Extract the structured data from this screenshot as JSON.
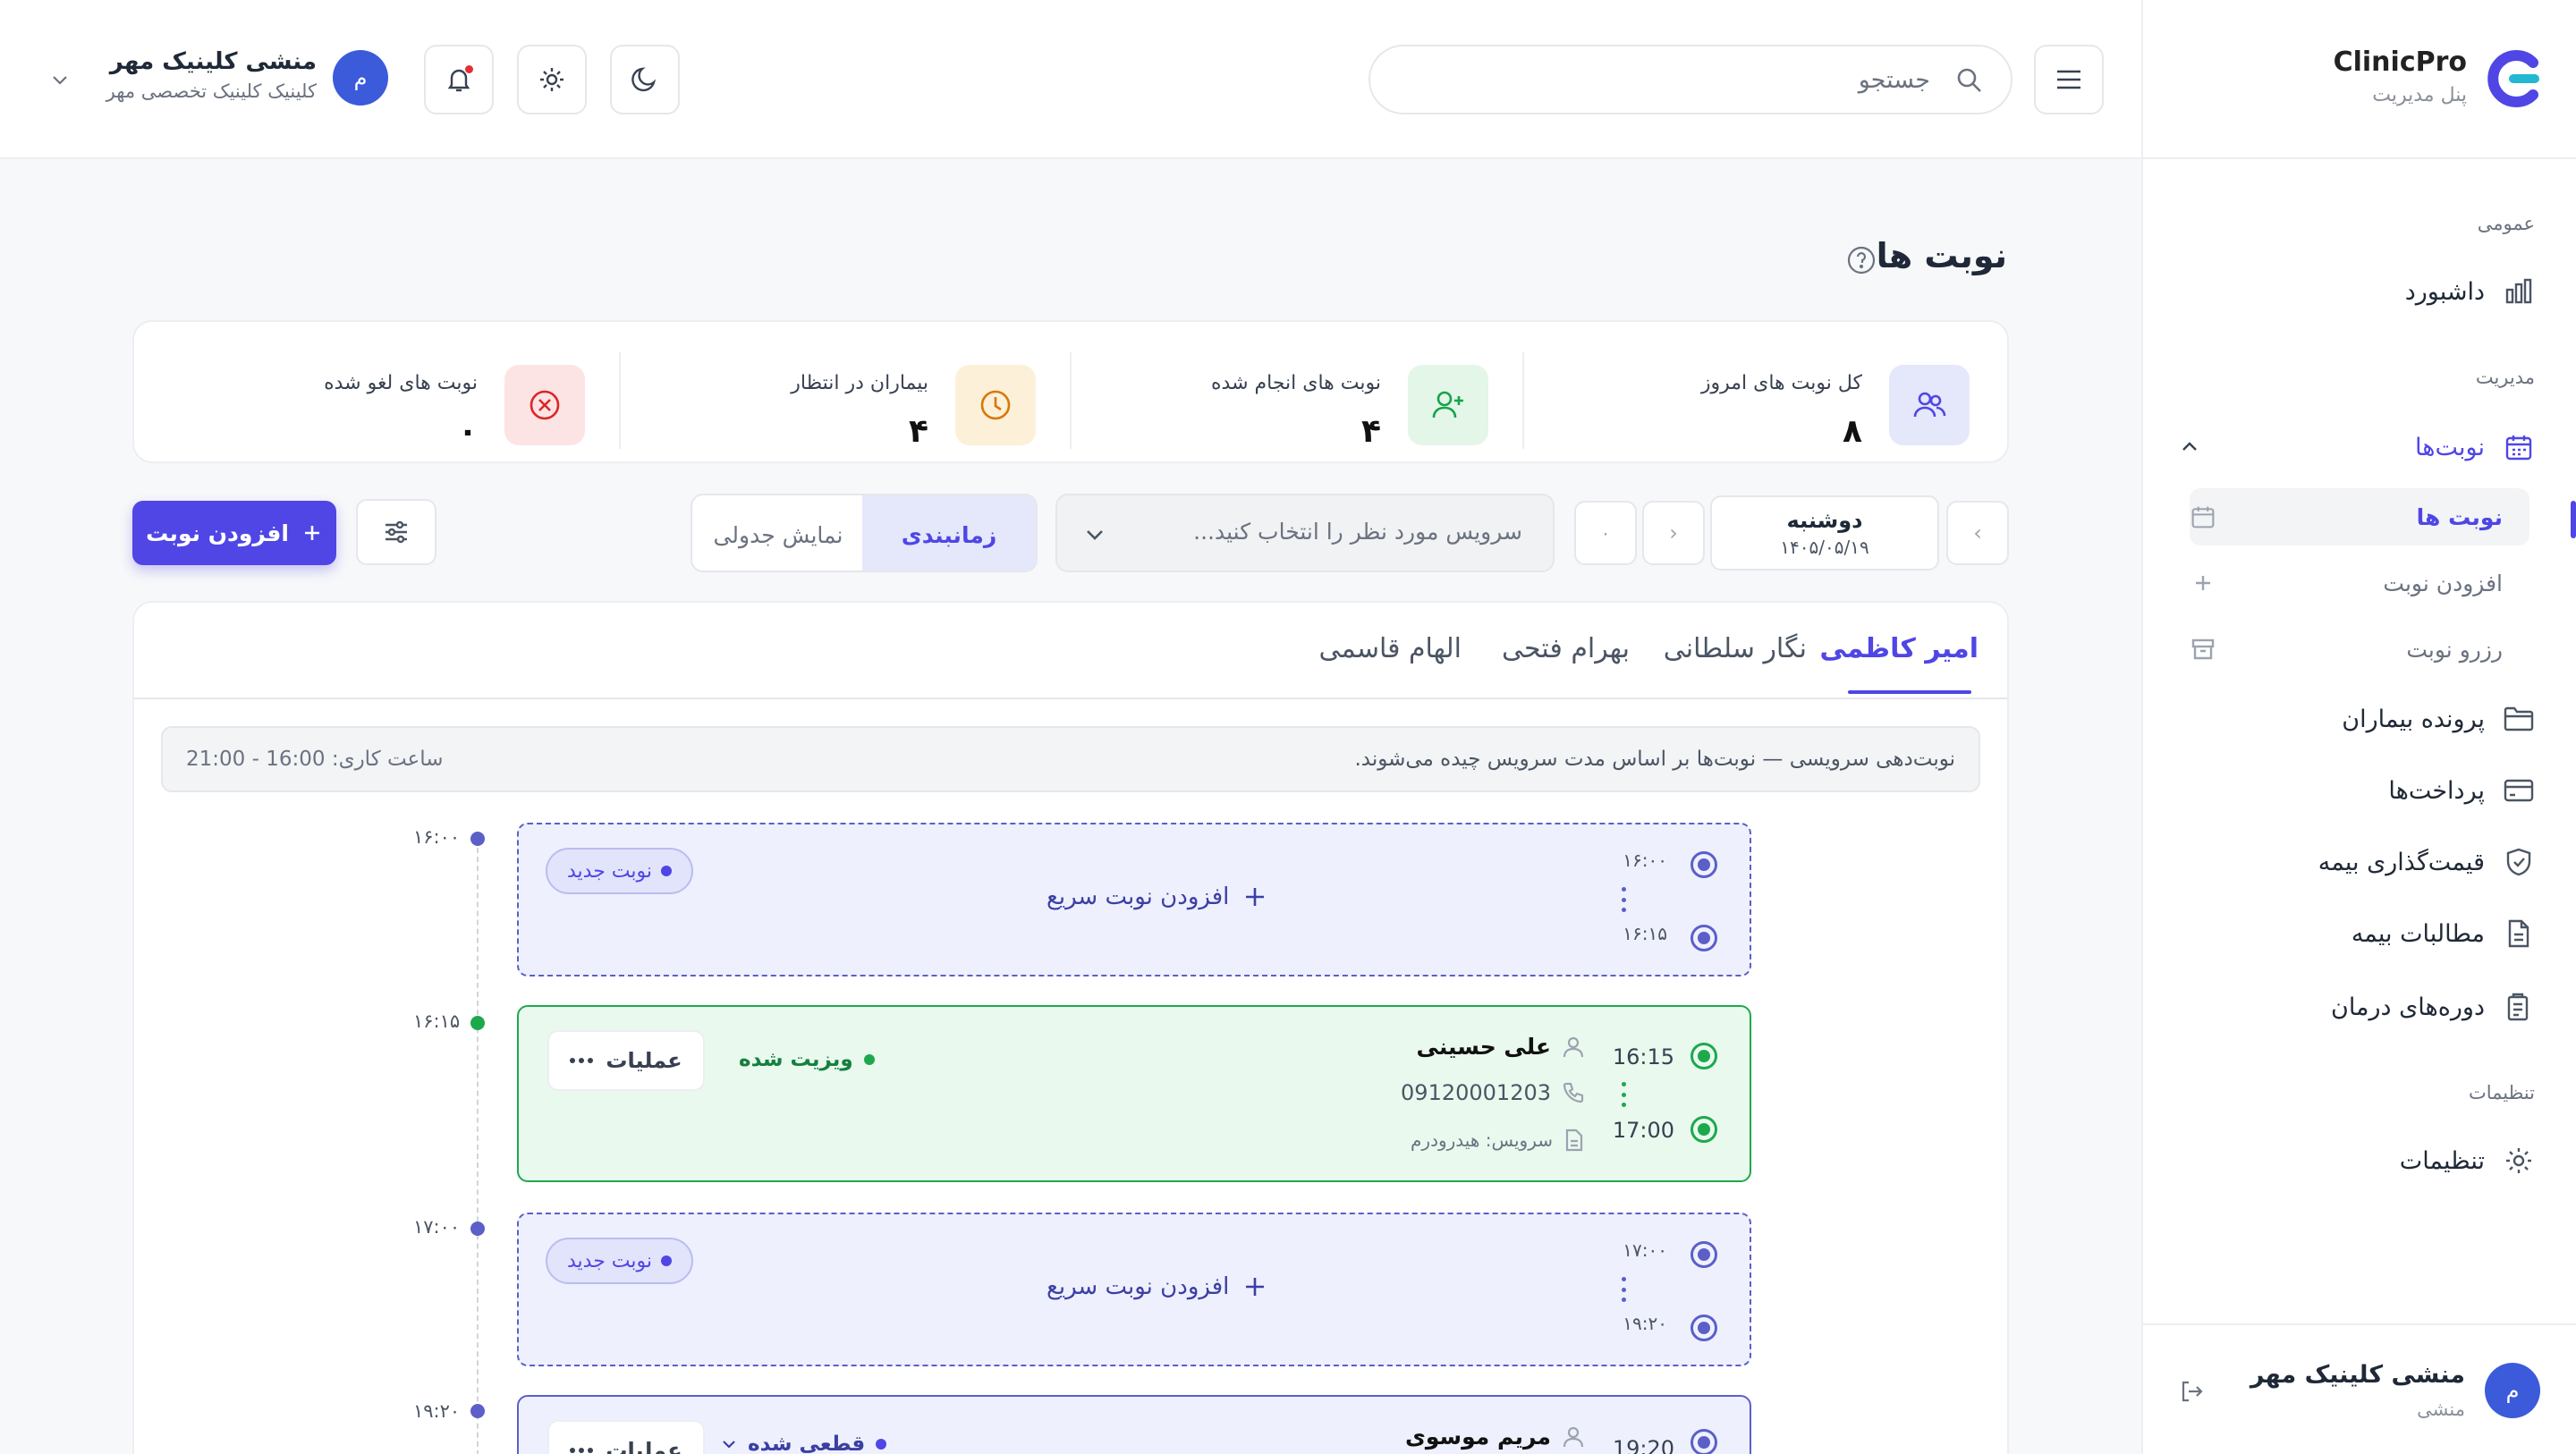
{
  "brand": {
    "name": "ClinicPro",
    "subtitle": "پنل مدیریت"
  },
  "sidebar": {
    "sections": {
      "general": "عمومی",
      "management": "مدیریت",
      "settings": "تنظیمات"
    },
    "dashboard": "داشبورد",
    "appointments": "نوبت‌ها",
    "sub": {
      "list": "نوبت ها",
      "add": "افزودن نوبت",
      "reserve": "رزرو نوبت"
    },
    "patients": "پرونده بیماران",
    "payments": "پرداخت‌ها",
    "insurance_pricing": "قیمت‌گذاری بیمه",
    "insurance_claims": "مطالبات بیمه",
    "treatment_courses": "دوره‌های درمان",
    "settings": "تنظیمات",
    "user": {
      "name": "منشی کلینیک مهر",
      "role": "منشی",
      "initial": "م"
    }
  },
  "header": {
    "search_placeholder": "جستجو",
    "user": {
      "name": "منشی کلینیک مهر",
      "clinic": "کلینیک کلینیک تخصصی مهر",
      "initial": "م"
    }
  },
  "page": {
    "title": "نوبت ها"
  },
  "stats": [
    {
      "label": "کل نوبت های امروز",
      "value": "۸",
      "icon": "users-icon",
      "color": "#4f46e5"
    },
    {
      "label": "نوبت های انجام شده",
      "value": "۴",
      "icon": "user-plus-icon",
      "color": "#16a34a"
    },
    {
      "label": "بیماران در انتظار",
      "value": "۴",
      "icon": "clock-icon",
      "color": "#d97706"
    },
    {
      "label": "نوبت های لغو شده",
      "value": "۰",
      "icon": "x-circle-icon",
      "color": "#dc2626"
    }
  ],
  "toolbar": {
    "day": "دوشنبه",
    "date": "۱۴۰۵/۰۵/۱۹",
    "today_mark": "۰",
    "service_placeholder": "سرویس مورد نظر را انتخاب کنید...",
    "view_table": "نمایش جدولی",
    "view_schedule": "زمانبندی",
    "add_button": "افزودن نوبت"
  },
  "doctors": [
    "امیر کاظمی",
    "نگار سلطانی",
    "بهرام فتحی",
    "الهام قاسمی"
  ],
  "info": {
    "text": "نوبت‌دهی سرویسی — نوبت‌ها بر اساس مدت سرویس چیده می‌شوند.",
    "hours": "ساعت کاری: 16:00 - 21:00"
  },
  "timeline": [
    "۱۶:۰۰",
    "۱۶:۱۵",
    "۱۷:۰۰",
    "۱۹:۲۰"
  ],
  "slots": [
    {
      "start": "۱۶:۰۰",
      "end": "۱۶:۱۵",
      "badge": "نوبت جدید",
      "action": "افزودن نوبت سریع"
    },
    {
      "start": "16:15",
      "end": "17:00",
      "patient": "علی حسینی",
      "phone": "09120001203",
      "service": "سرویس: هیدرودرم",
      "status": "ویزیت شده",
      "ops": "عملیات"
    },
    {
      "start": "۱۷:۰۰",
      "end": "۱۹:۲۰",
      "badge": "نوبت جدید",
      "action": "افزودن نوبت سریع"
    },
    {
      "start": "19:20",
      "patient": "مریم موسوی",
      "status": "قطعی شده",
      "ops": "عملیات"
    }
  ]
}
